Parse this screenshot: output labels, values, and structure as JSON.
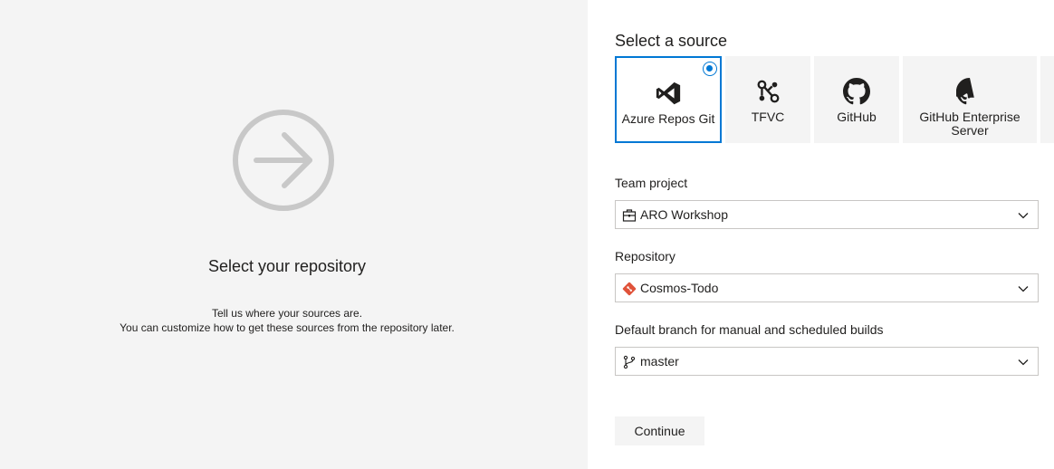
{
  "left": {
    "title": "Select your repository",
    "desc_line1": "Tell us where your sources are.",
    "desc_line2": "You can customize how to get these sources from the repository later."
  },
  "source": {
    "title": "Select a source",
    "options": [
      {
        "label": "Azure Repos Git",
        "icon": "visual-studio-icon",
        "selected": true
      },
      {
        "label": "TFVC",
        "icon": "tfvc-icon",
        "selected": false
      },
      {
        "label": "GitHub",
        "icon": "github-icon",
        "selected": false
      },
      {
        "label": "GitHub Enterprise Server",
        "icon": "github-icon",
        "selected": false
      }
    ]
  },
  "fields": {
    "team_project": {
      "label": "Team project",
      "value": "ARO Workshop",
      "icon": "project-icon"
    },
    "repository": {
      "label": "Repository",
      "value": "Cosmos-Todo",
      "icon": "git-repo-icon"
    },
    "branch": {
      "label": "Default branch for manual and scheduled builds",
      "value": "master",
      "icon": "branch-icon"
    }
  },
  "actions": {
    "continue_label": "Continue"
  },
  "colors": {
    "accent": "#0078d4",
    "git_red": "#e0533a",
    "left_bg": "#f4f4f4",
    "hero_icon": "#c8c8c8"
  }
}
